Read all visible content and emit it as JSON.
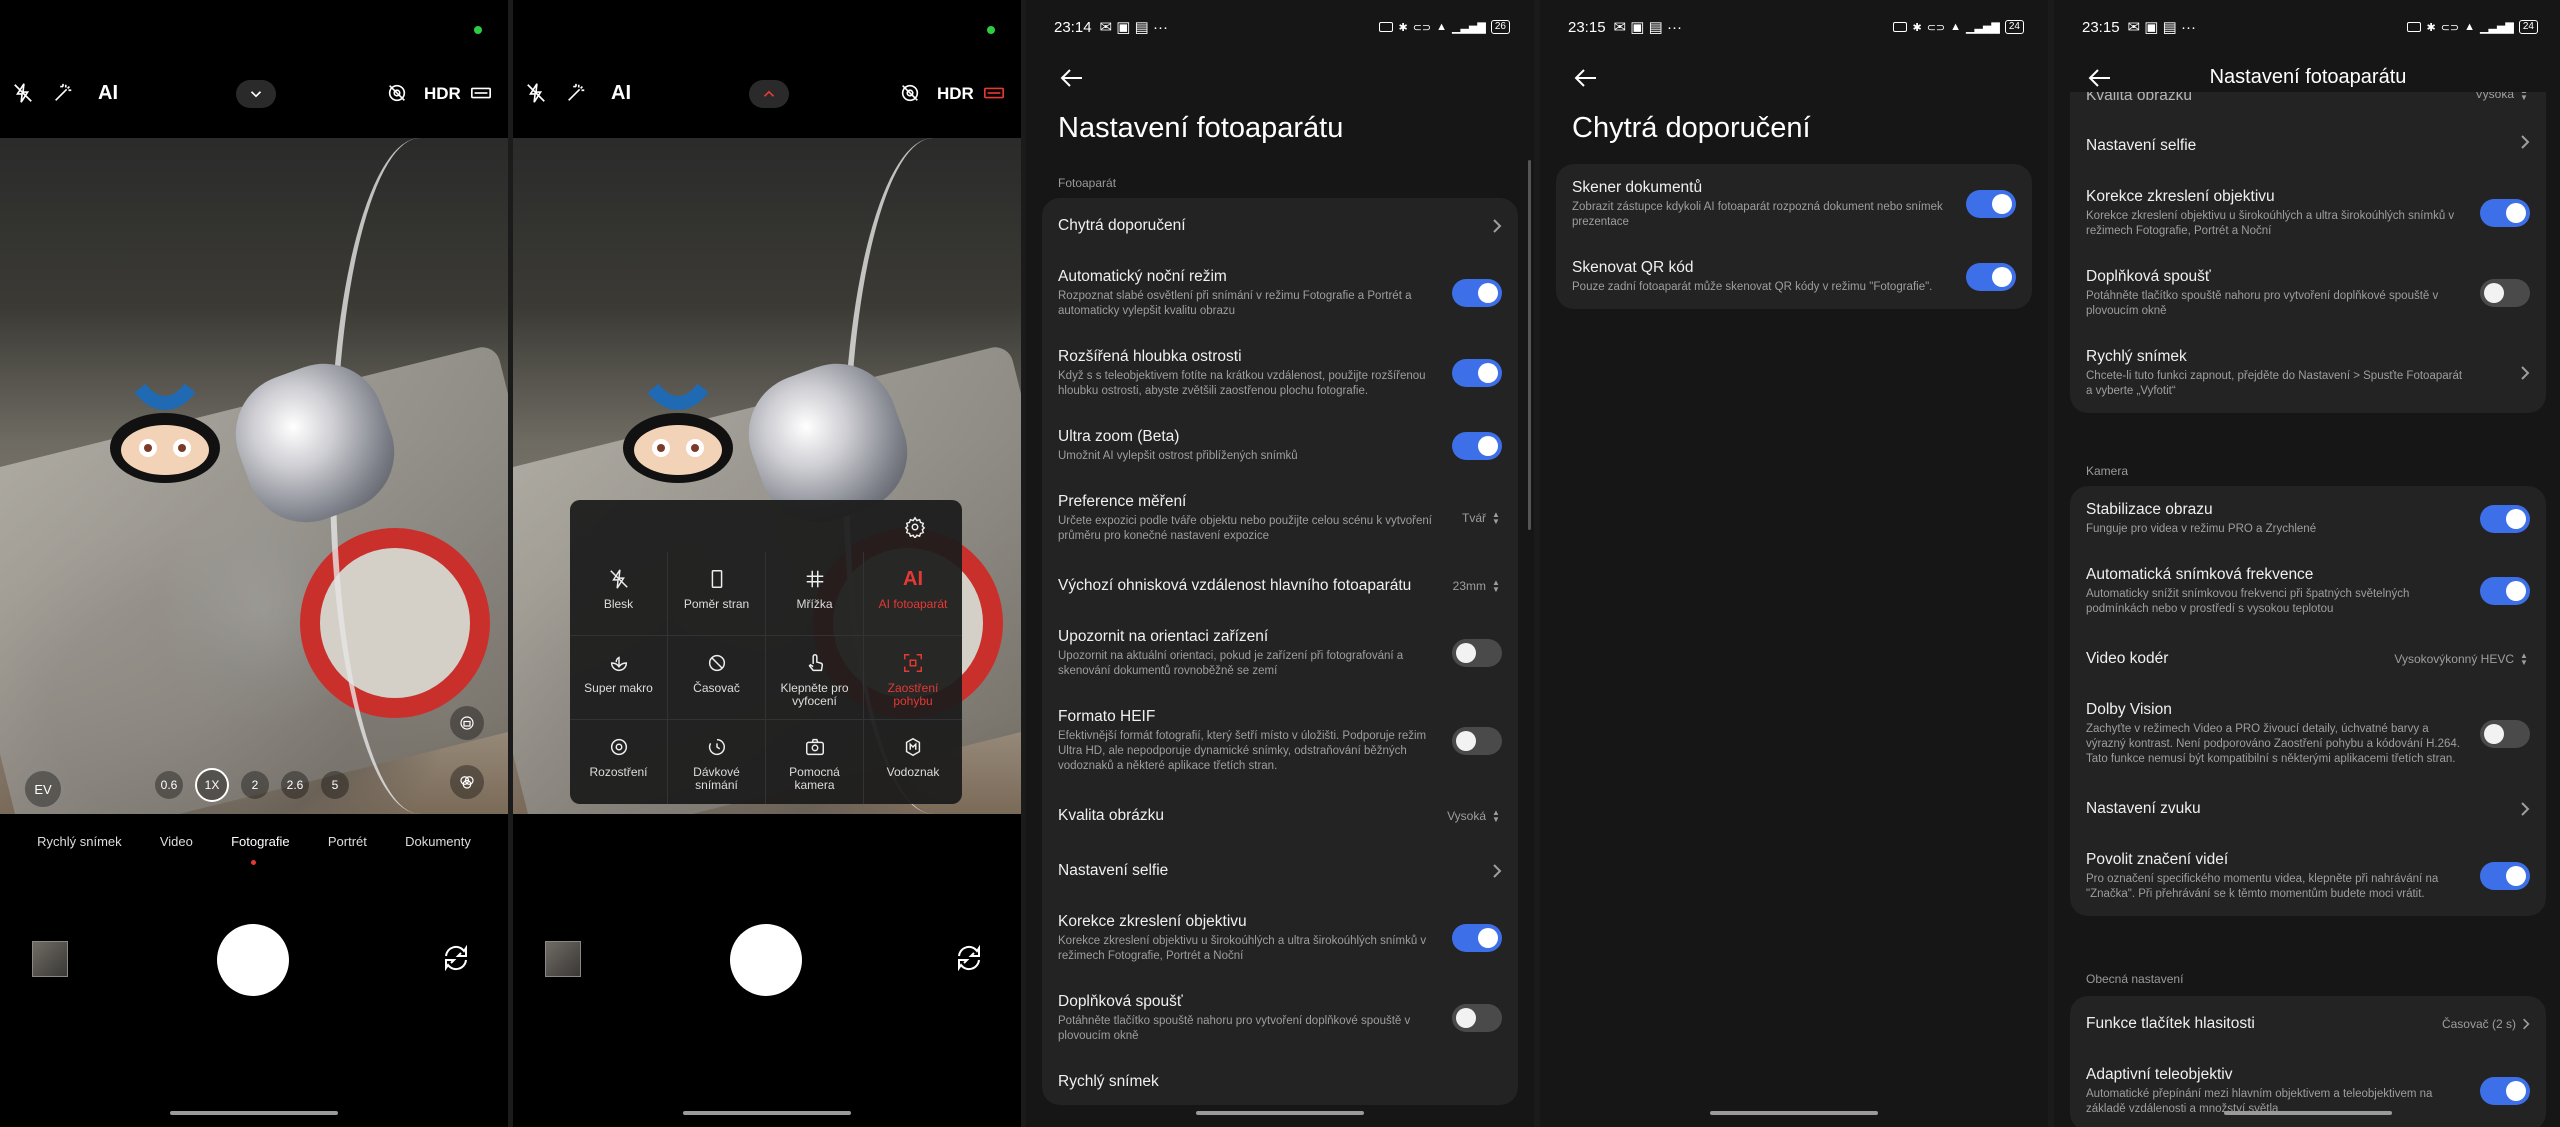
{
  "camera1": {
    "ai_label": "AI",
    "hdr_label": "HDR",
    "ev_label": "EV",
    "zoom": [
      "0.6",
      "1X",
      "2",
      "2.6",
      "5"
    ],
    "modes": [
      "Rychlý snímek",
      "Video",
      "Fotografie",
      "Portrét",
      "Dokumenty"
    ],
    "active_mode": "Fotografie"
  },
  "camera2": {
    "ai_label": "AI",
    "hdr_label": "HDR",
    "menu": [
      {
        "label": "Blesk",
        "icon": "flash-off-icon",
        "active": false
      },
      {
        "label": "Poměr stran",
        "icon": "aspect-ratio-icon",
        "active": false
      },
      {
        "label": "Mřížka",
        "icon": "grid-icon",
        "active": false
      },
      {
        "label": "AI fotoaparát",
        "icon": "ai-icon",
        "active": true
      },
      {
        "label": "Super makro",
        "icon": "macro-icon",
        "active": false
      },
      {
        "label": "Časovač",
        "icon": "timer-icon",
        "active": false
      },
      {
        "label": "Klepněte pro vyfocení",
        "icon": "tap-icon",
        "active": false
      },
      {
        "label": "Zaostření pohybu",
        "icon": "motion-focus-icon",
        "active": true
      },
      {
        "label": "Rozostření",
        "icon": "blur-icon",
        "active": false
      },
      {
        "label": "Dávkové snímání",
        "icon": "burst-icon",
        "active": false
      },
      {
        "label": "Pomocná kamera",
        "icon": "assist-camera-icon",
        "active": false
      },
      {
        "label": "Vodoznak",
        "icon": "watermark-icon",
        "active": false
      }
    ]
  },
  "status3": {
    "time": "23:14",
    "battery": "26"
  },
  "status4": {
    "time": "23:15",
    "battery": "24"
  },
  "status5": {
    "time": "23:15",
    "battery": "24"
  },
  "settings": {
    "title": "Nastavení fotoaparátu",
    "section": "Fotoaparát",
    "items": [
      {
        "title": "Chytrá doporučení",
        "desc": "",
        "control": "arrow"
      },
      {
        "title": "Automatický noční režim",
        "desc": "Rozpoznat slabé osvětlení při snímání v režimu Fotografie a Portrét a automaticky vylepšit kvalitu obrazu",
        "control": "on"
      },
      {
        "title": "Rozšířená hloubka ostrosti",
        "desc": "Když s s teleobjektivem fotíte na krátkou vzdálenost, použijte rozšířenou hloubku ostrosti, abyste zvětšili zaostřenou plochu fotografie.",
        "control": "on"
      },
      {
        "title": "Ultra zoom (Beta)",
        "desc": "Umožnit AI vylepšit ostrost přiblížených snímků",
        "control": "on"
      },
      {
        "title": "Preference měření",
        "desc": "Určete expozici podle tváře objektu nebo použijte celou scénu k vytvoření průměru pro konečné nastavení expozice",
        "control": "value",
        "value": "Tvář"
      },
      {
        "title": "Výchozí ohnisková vzdálenost hlavního fotoaparátu",
        "desc": "",
        "control": "value",
        "value": "23mm"
      },
      {
        "title": "Upozornit na orientaci zařízení",
        "desc": "Upozornit na aktuální orientaci, pokud je zařízení při fotografování a skenování dokumentů rovnoběžně se zemí",
        "control": "off"
      },
      {
        "title": "Formato HEIF",
        "desc": "Efektivnější formát fotografií, který šetří místo v úložišti. Podporuje režim Ultra HD, ale nepodporuje dynamické snímky, odstraňování běžných vodoznaků a některé aplikace třetích stran.",
        "control": "off"
      },
      {
        "title": "Kvalita obrázku",
        "desc": "",
        "control": "value",
        "value": "Vysoká"
      },
      {
        "title": "Nastavení selfie",
        "desc": "",
        "control": "arrow"
      },
      {
        "title": "Korekce zkreslení objektivu",
        "desc": "Korekce zkreslení objektivu u širokoúhlých a ultra širokoúhlých snímků v režimech Fotografie, Portrét a Noční",
        "control": "on"
      },
      {
        "title": "Doplňková spoušť",
        "desc": "Potáhněte tlačítko spouště nahoru pro vytvoření doplňkové spouště v plovoucím okně",
        "control": "off"
      },
      {
        "title": "Rychlý snímek",
        "desc": "",
        "control": "none"
      }
    ]
  },
  "smart": {
    "title": "Chytrá doporučení",
    "items": [
      {
        "title": "Skener dokumentů",
        "desc": "Zobrazit zástupce kdykoli AI fotoaparát rozpozná dokument nebo snímek prezentace",
        "control": "on"
      },
      {
        "title": "Skenovat QR kód",
        "desc": "Pouze zadní fotoaparát může skenovat QR kódy v režimu \"Fotografie\".",
        "control": "on"
      }
    ]
  },
  "settings2": {
    "title": "Nastavení fotoaparátu",
    "top_partial": {
      "title": "Kvalita obrázku",
      "value": "Vysoká"
    },
    "card1": [
      {
        "title": "Nastavení selfie",
        "desc": "",
        "control": "arrow"
      },
      {
        "title": "Korekce zkreslení objektivu",
        "desc": "Korekce zkreslení objektivu u širokoúhlých a ultra širokoúhlých snímků v režimech Fotografie, Portrét a Noční",
        "control": "on"
      },
      {
        "title": "Doplňková spoušť",
        "desc": "Potáhněte tlačítko spouště nahoru pro vytvoření doplňkové spouště v plovoucím okně",
        "control": "off"
      },
      {
        "title": "Rychlý snímek",
        "desc": "Chcete-li tuto funkci zapnout, přejděte do Nastavení > Spusťte Fotoaparát a vyberte „Vyfotit“",
        "control": "arrow"
      }
    ],
    "section_camera": "Kamera",
    "card2": [
      {
        "title": "Stabilizace obrazu",
        "desc": "Funguje pro videa v režimu PRO a Zrychlené",
        "control": "on"
      },
      {
        "title": "Automatická snímková frekvence",
        "desc": "Automaticky snížit snímkovou frekvenci při špatných světelných podmínkách nebo v prostředí s vysokou teplotou",
        "control": "on"
      },
      {
        "title": "Video kodér",
        "desc": "",
        "control": "value",
        "value": "Vysokovýkonný HEVC"
      },
      {
        "title": "Dolby Vision",
        "desc": "Zachyťte v režimech Video a PRO živoucí detaily, úchvatné barvy a výrazný kontrast. Není podporováno Zaostření pohybu a kódování H.264. Tato funkce nemusí být kompatibilní s některými aplikacemi třetích stran.",
        "control": "off"
      },
      {
        "title": "Nastavení zvuku",
        "desc": "",
        "control": "arrow"
      },
      {
        "title": "Povolit značení videí",
        "desc": "Pro označení specifického momentu videa, klepněte při nahrávání na \"Značka\". Při přehrávání se k těmto momentům budete moci vrátit.",
        "control": "on"
      }
    ],
    "section_general": "Obecná nastavení",
    "card3": [
      {
        "title": "Funkce tlačítek hlasitosti",
        "desc": "",
        "control": "value-arrow",
        "value": "Časovač (2 s)"
      },
      {
        "title": "Adaptivní teleobjektiv",
        "desc": "Automatické přepínání mezi hlavním objektivem a teleobjektivem na základě vzdálenosti a množství světla",
        "control": "on"
      }
    ]
  },
  "colors": {
    "accent": "#3d6fe8",
    "active_red": "#e53935",
    "card": "#232323",
    "bg": "#161616"
  }
}
